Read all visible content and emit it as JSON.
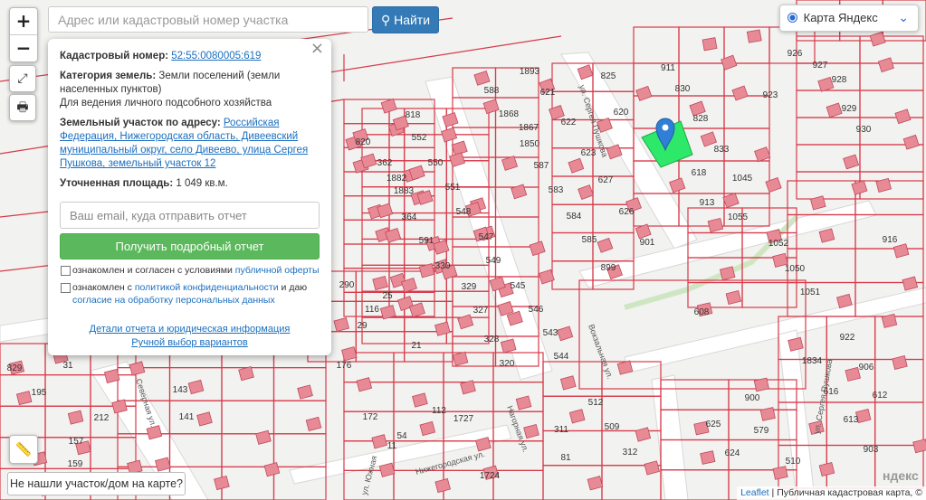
{
  "controls": {
    "zoom_in": "+",
    "zoom_out": "−",
    "search_placeholder": "Адрес или кадастровый номер участка",
    "find_label": "Найти",
    "layer_label": "Карта Яндекс",
    "not_found_label": "Не нашли участок/дом на карте?"
  },
  "panel": {
    "cadastral_label": "Кадастровый номер:",
    "cadastral_number": "52:55:0080005:619",
    "category_label": "Категория земель:",
    "category_value": "Земли поселений (земли населенных пунктов)",
    "usage_value": "Для ведения личного подсобного хозяйства",
    "address_label": "Земельный участок по адресу:",
    "address_value": "Российская Федерация, Нижегородская область, Дивеевский муниципальный округ, село Дивеево, улица Сергея Пушкова, земельный участок 12",
    "area_label": "Уточненная площадь:",
    "area_value": "1 049 кв.м.",
    "email_placeholder": "Ваш email, куда отправить отчет",
    "report_button": "Получить подробный отчет",
    "consent1_prefix": "ознакомлен и согласен с условиями",
    "consent1_link": "публичной оферты",
    "consent2_prefix": "ознакомлен с",
    "consent2_link1": "политикой конфиденциальности",
    "consent2_mid": "и даю",
    "consent2_link2": "согласие на обработку персональных данных",
    "details_link": "Детали отчета и юридическая информация",
    "manual_link": "Ручной выбор вариантов"
  },
  "attribution": {
    "leaflet": "Leaflet",
    "sep": "|",
    "source": "Публичная кадастровая карта, ©",
    "brand": "ндекс"
  },
  "streets": [
    {
      "id": "s1",
      "text": "ул. Сергея Пушкова"
    },
    {
      "id": "s2",
      "text": "Северная ул."
    },
    {
      "id": "s3",
      "text": "Нижегородская ул."
    },
    {
      "id": "s4",
      "text": "Нагорная ул."
    },
    {
      "id": "s5",
      "text": "Вокзальная ул."
    },
    {
      "id": "s6",
      "text": "ул. Сергея Пушкова"
    },
    {
      "id": "s7",
      "text": "ул. Южная"
    }
  ],
  "parcels": [
    "1893",
    "621",
    "825",
    "911",
    "830",
    "588",
    "1868",
    "1867",
    "622",
    "828",
    "620",
    "1850",
    "623",
    "833",
    "587",
    "627",
    "618",
    "1045",
    "583",
    "626",
    "913",
    "584",
    "585",
    "901",
    "899",
    "1055",
    "1052",
    "1050",
    "1051",
    "608",
    "916",
    "923",
    "926",
    "927",
    "928",
    "929",
    "930",
    "818",
    "820",
    "552",
    "362",
    "1882",
    "550",
    "551",
    "1883",
    "548",
    "364",
    "547",
    "591",
    "549",
    "330",
    "545",
    "546",
    "329",
    "327",
    "543",
    "328",
    "544",
    "320",
    "290",
    "116",
    "176",
    "143",
    "195",
    "31",
    "212",
    "157",
    "159",
    "141",
    "172",
    "112",
    "54",
    "11",
    "829",
    "922",
    "1834",
    "906",
    "616",
    "612",
    "613",
    "903",
    "900",
    "625",
    "579",
    "624",
    "510",
    "512",
    "509",
    "312",
    "311",
    "81",
    "1724",
    "29",
    "25",
    "21",
    "1727"
  ]
}
